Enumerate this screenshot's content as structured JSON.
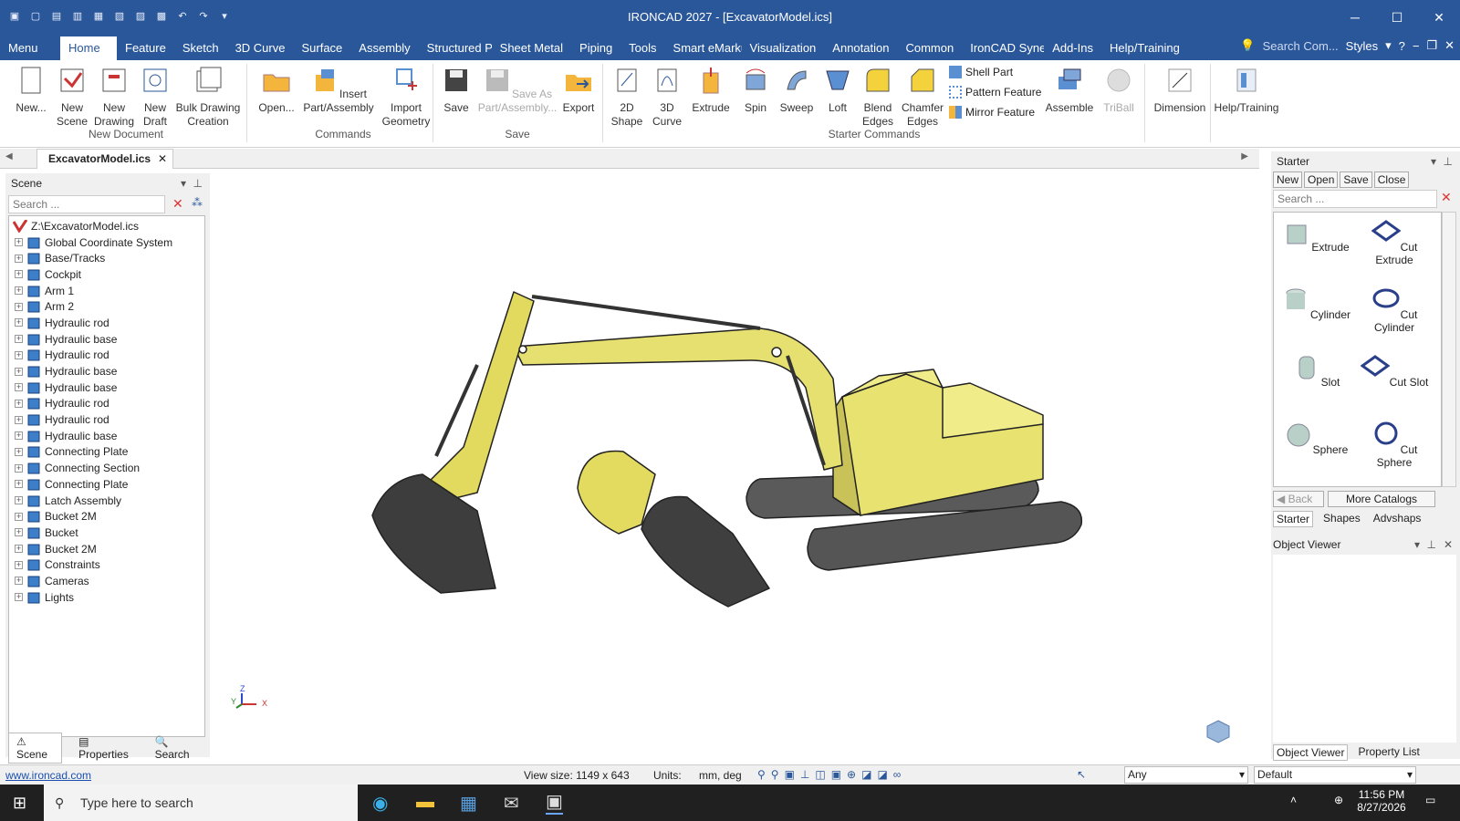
{
  "window": {
    "title": "IRONCAD 2027 - [ExcavatorModel.ics]",
    "minimize": "─",
    "maximize": "☐",
    "close": "✕"
  },
  "ribbon_tabs": [
    "Menu",
    "Home",
    "Feature",
    "Sketch",
    "3D Curve",
    "Surface",
    "Assembly",
    "Structured Pa",
    "Sheet Metal",
    "Piping",
    "Tools",
    "Smart eMarku",
    "Visualization",
    "Annotation",
    "Common",
    "IronCAD Syne",
    "Add-Ins",
    "Help/Training"
  ],
  "tab_right": {
    "search_placeholder": "Search Com...",
    "styles": "Styles"
  },
  "ribbon": {
    "new": "New...",
    "new_scene": "New\nScene",
    "new_drawing": "New\nDrawing",
    "new_draft": "New\nDraft",
    "bulk": "Bulk Drawing\nCreation",
    "group_new": "New Document",
    "open": "Open...",
    "insert": "Insert\nPart/Assembly",
    "import": "Import\nGeometry",
    "group_cmd": "Commands",
    "save": "Save",
    "saveas": "Save As\nPart/Assembly...",
    "export": "Export",
    "group_save": "Save",
    "shape2d": "2D\nShape",
    "curve3d": "3D\nCurve",
    "extrude": "Extrude",
    "spin": "Spin",
    "sweep": "Sweep",
    "loft": "Loft",
    "blend": "Blend\nEdges",
    "chamfer": "Chamfer\nEdges",
    "shell": "Shell Part",
    "pattern": "Pattern Feature",
    "mirror": "Mirror Feature",
    "assemble": "Assemble",
    "triball": "TriBall",
    "group_starter": "Starter Commands",
    "dimension": "Dimension",
    "help": "Help/Training"
  },
  "doc_tab": "ExcavatorModel.ics",
  "scene": {
    "title": "Scene",
    "search_placeholder": "Search ...",
    "root": "Z:\\ExcavatorModel.ics",
    "items": [
      "Global Coordinate System",
      "Base/Tracks",
      "Cockpit",
      "Arm 1",
      "Arm 2",
      "Hydraulic rod",
      "Hydraulic base",
      "Hydraulic rod",
      "Hydraulic base",
      "Hydraulic base",
      "Hydraulic rod",
      "Hydraulic rod",
      "Hydraulic base",
      "Connecting Plate",
      "Connecting Section",
      "Connecting Plate",
      "Latch Assembly",
      "Bucket 2M",
      "Bucket",
      "Bucket 2M",
      "Constraints",
      "Cameras",
      "Lights"
    ],
    "tabs": [
      "Scene",
      "Properties",
      "Search"
    ]
  },
  "starter": {
    "title": "Starter",
    "new": "New",
    "open": "Open",
    "save": "Save",
    "close": "Close",
    "search_placeholder": "Search ...",
    "items": [
      "Extrude",
      "Cut Extrude",
      "Cylinder",
      "Cut Cylinder",
      "Slot",
      "Cut Slot",
      "Sphere",
      "Cut Sphere"
    ],
    "back": "Back",
    "more": "More Catalogs",
    "tabs": [
      "Starter",
      "Shapes",
      "Advshaps"
    ]
  },
  "object_viewer": {
    "title": "Object Viewer",
    "tabs": [
      "Object Viewer",
      "Property List"
    ]
  },
  "axis": {
    "z": "Z",
    "x": "X",
    "y": "Y"
  },
  "status": {
    "link": "www.ironcad.com",
    "view_size": "View size: 1149 x  643",
    "units_label": "Units:",
    "units": "mm, deg",
    "filter": "Any",
    "style": "Default"
  },
  "taskbar": {
    "search": "Type here to search",
    "time": "11:56 PM",
    "date": "8/27/2026"
  }
}
